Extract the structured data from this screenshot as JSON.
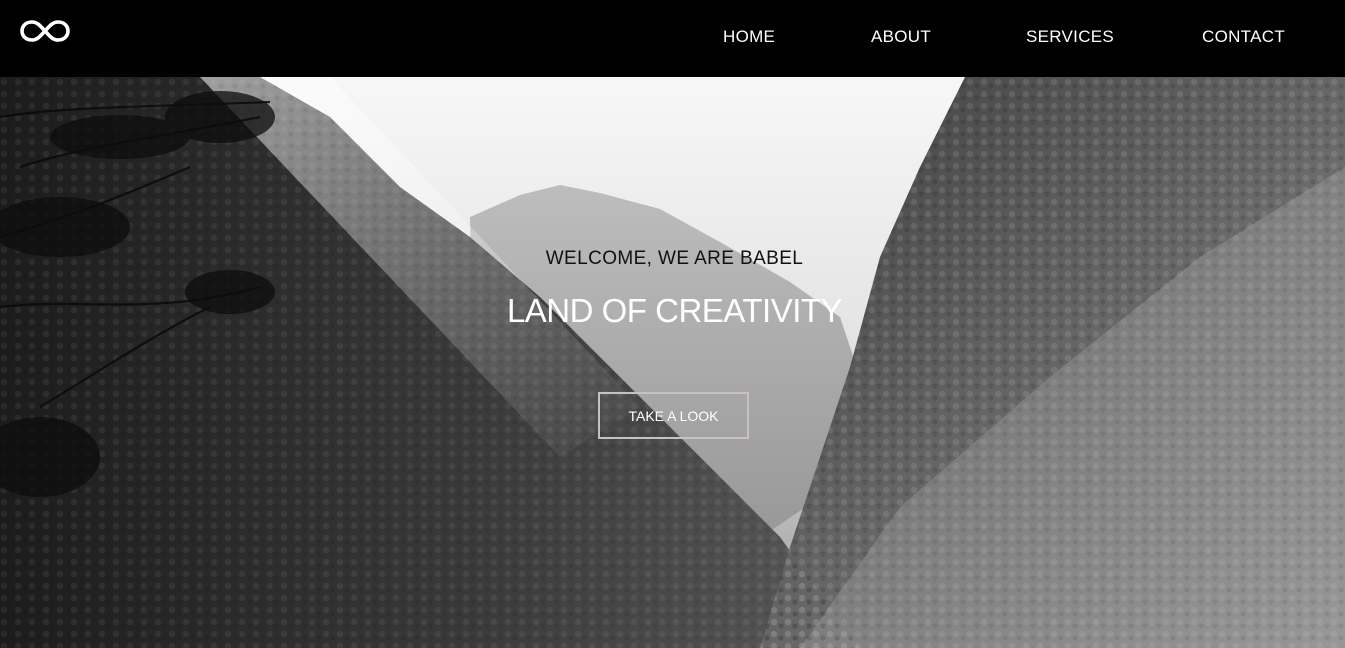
{
  "header": {
    "logo_icon": "infinity-icon",
    "nav": {
      "home": "HOME",
      "about": "ABOUT",
      "services": "SERVICES",
      "contact": "CONTACT"
    }
  },
  "hero": {
    "subtitle": "WELCOME, WE ARE BABEL",
    "title": "LAND OF CREATIVITY",
    "cta_label": "TAKE A LOOK",
    "background_image": "grayscale mountain valley with forest",
    "colors": {
      "header_bg": "#000000",
      "subtitle": "#111111",
      "title": "#ffffff",
      "cta_border": "#cbbfc2"
    }
  }
}
